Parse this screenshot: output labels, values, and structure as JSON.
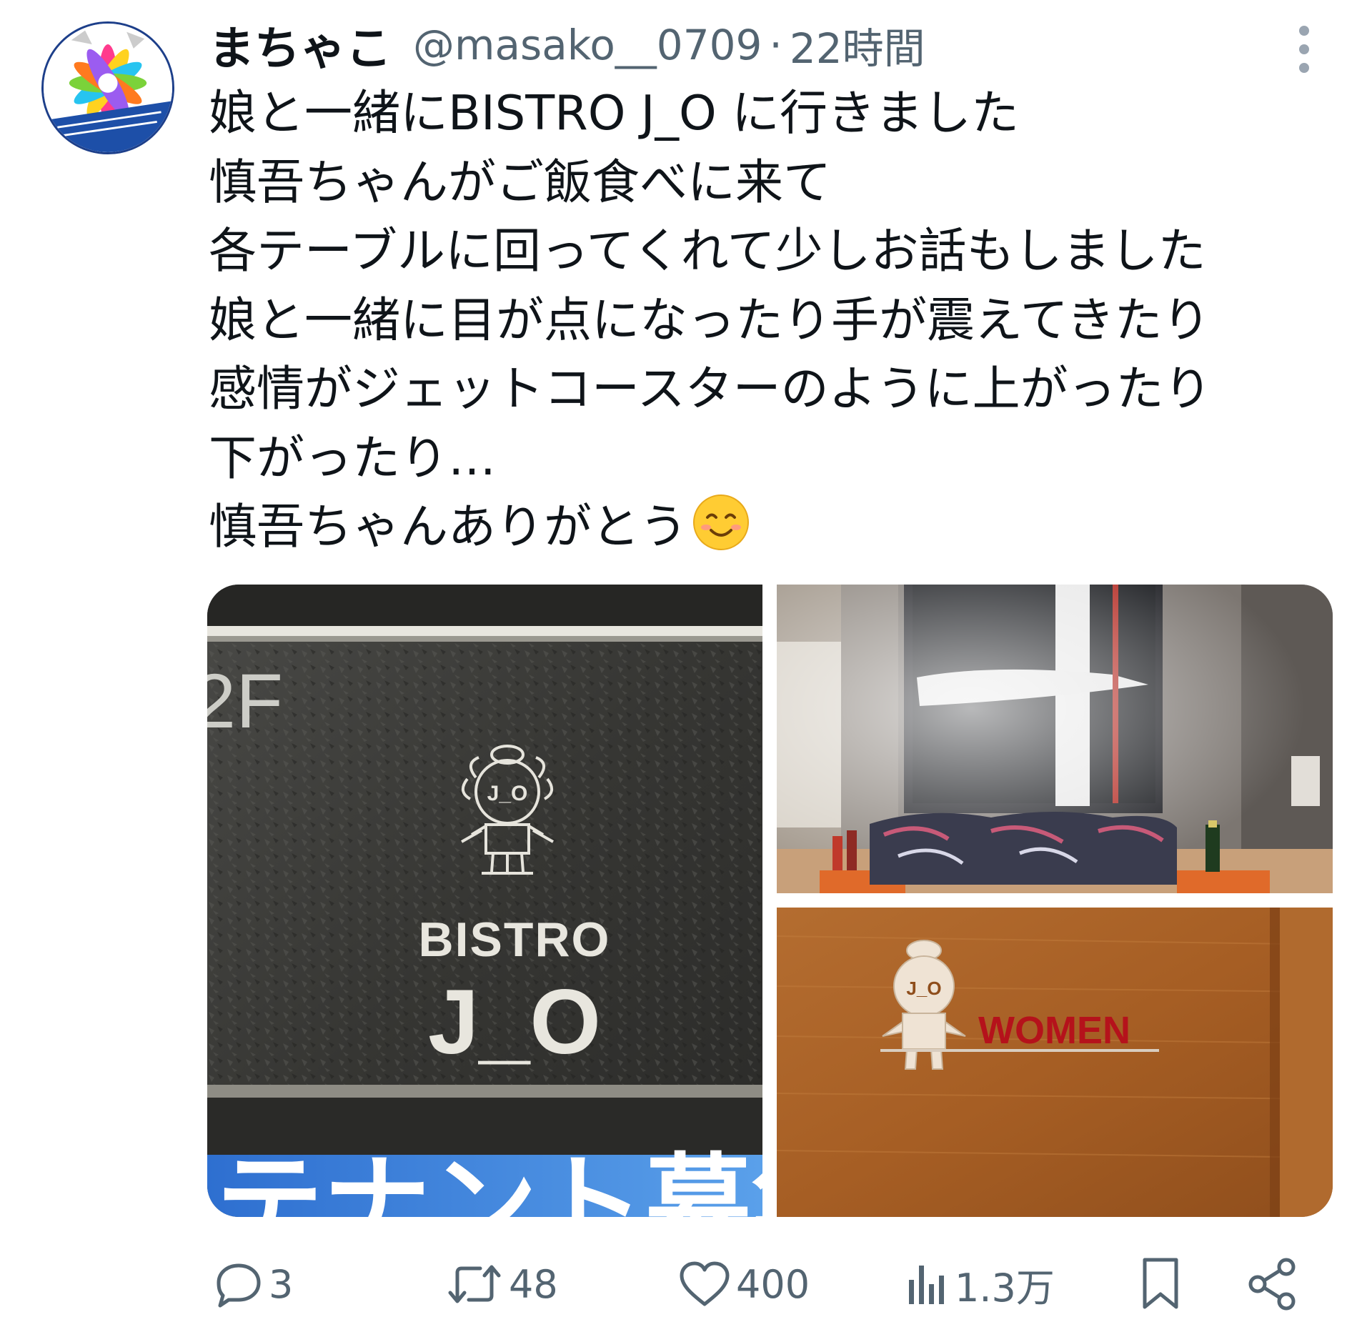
{
  "tweet": {
    "display_name": "まちゃこ",
    "handle": "@masako__0709",
    "separator": "·",
    "time": "22時間",
    "text_lines": [
      "娘と一緒にBISTRO J_O に行きました",
      "慎吾ちゃんがご飯食べに来て",
      "各テーブルに回ってくれて少しお話もしました",
      "娘と一緒に目が点になったり手が震えてきたり",
      "感情がジェットコースターのように上がったり",
      "下がったり…",
      "慎吾ちゃんありがとう"
    ],
    "emoji": "smiling-face-emoji"
  },
  "media": {
    "left_photo": {
      "floor": "2F",
      "sign_line1": "BISTRO",
      "sign_line2": "J_O",
      "logo_text": "J_O",
      "banner_text": "テナント募集"
    },
    "bottom_right_photo": {
      "logo_text": "J_O",
      "door_sign": "WOMEN",
      "sign_color": "#b5121b"
    }
  },
  "actions": {
    "replies": "3",
    "retweets": "48",
    "likes": "400",
    "views": "1.3万"
  },
  "colors": {
    "text": "#0f1419",
    "muted": "#536471"
  }
}
